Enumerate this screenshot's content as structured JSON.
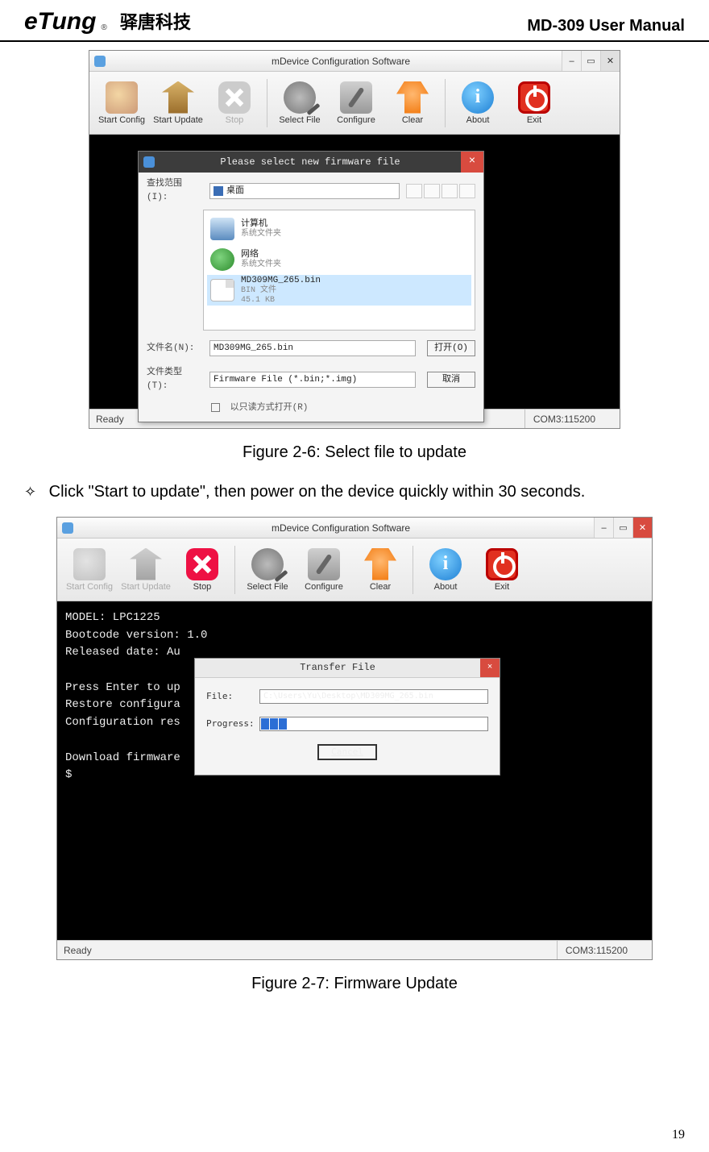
{
  "header": {
    "logo_text": "eTung",
    "logo_reg": "®",
    "brand_ch": "驿唐科技",
    "manual_title": "MD-309 User Manual"
  },
  "figure1": {
    "window_title": "mDevice Configuration Software",
    "toolbar": {
      "start_config": "Start Config",
      "start_update": "Start Update",
      "stop": "Stop",
      "select_file": "Select File",
      "configure": "Configure",
      "clear": "Clear",
      "about": "About",
      "exit": "Exit"
    },
    "status": {
      "ready": "Ready",
      "com": "COM3:115200"
    },
    "dialog": {
      "title": "Please select new firmware file",
      "look_in_label": "查找范围(I):",
      "look_in_value": "桌面",
      "items": {
        "computer_name": "计算机",
        "computer_sub": "系统文件夹",
        "network_name": "网络",
        "network_sub": "系统文件夹",
        "file_name": "MD309MG_265.bin",
        "file_sub1": "BIN 文件",
        "file_sub2": "45.1 KB"
      },
      "filename_label": "文件名(N):",
      "filename_value": "MD309MG_265.bin",
      "filetype_label": "文件类型(T):",
      "filetype_value": "Firmware File (*.bin;*.img)",
      "open_btn": "打开(O)",
      "cancel_btn": "取消",
      "readonly": "以只读方式打开(R)"
    },
    "caption": "Figure 2-6: Select file to update"
  },
  "body": {
    "bullet_text": "Click \"Start to update\", then power on the device quickly within 30 seconds."
  },
  "figure2": {
    "window_title": "mDevice Configuration Software",
    "toolbar": {
      "start_config": "Start Config",
      "start_update": "Start Update",
      "stop": "Stop",
      "select_file": "Select File",
      "configure": "Configure",
      "clear": "Clear",
      "about": "About",
      "exit": "Exit"
    },
    "console": {
      "l1": "MODEL: LPC1225",
      "l2": "Bootcode version: 1.0",
      "l3": "Released date: Au",
      "l4": "",
      "l5": "Press Enter to up",
      "l6": "Restore configura",
      "l7": "Configuration res",
      "l8": "",
      "l9": "Download firmware",
      "l10": "$"
    },
    "transfer": {
      "title": "Transfer File",
      "file_label": "File:",
      "file_value": "C:\\Users\\Yu\\Desktop\\MD309MG_265.bin",
      "progress_label": "Progress:",
      "cancel": "Cancel"
    },
    "status": {
      "ready": "Ready",
      "com": "COM3:115200"
    },
    "caption": "Figure 2-7: Firmware Update"
  },
  "page_number": "19"
}
